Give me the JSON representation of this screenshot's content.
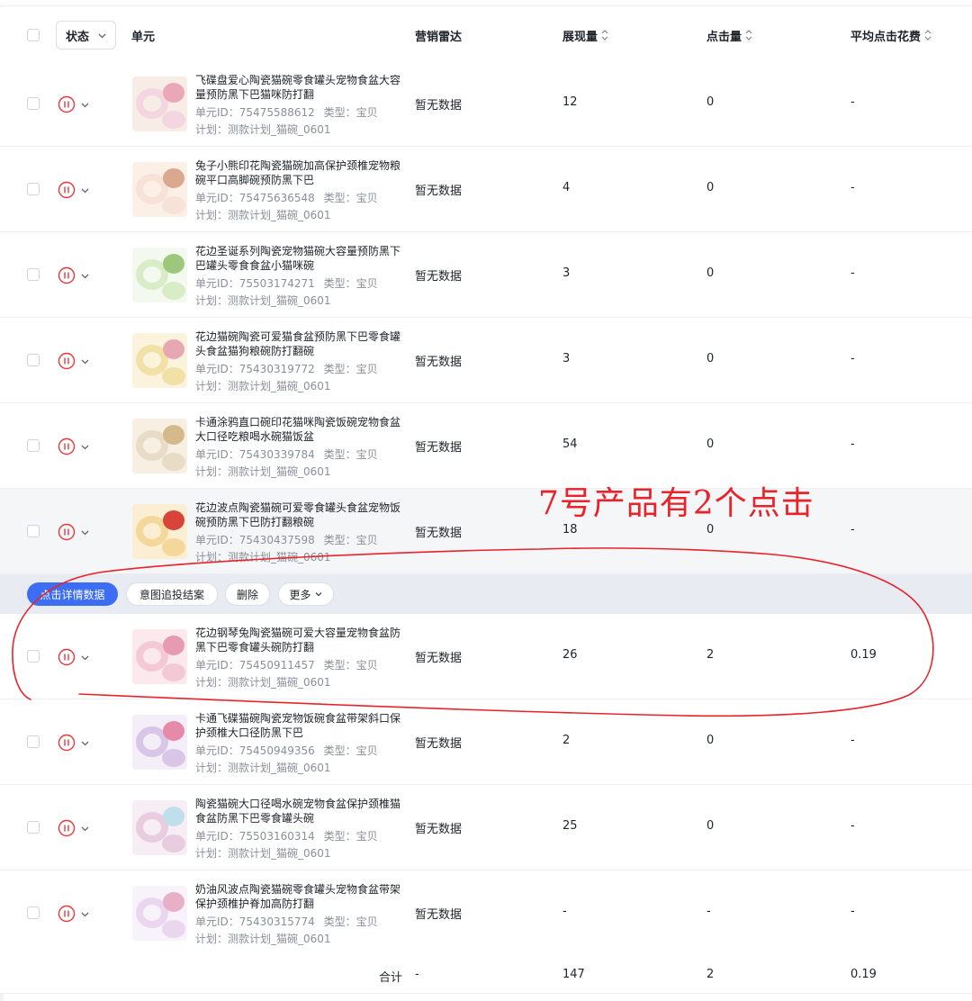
{
  "header": {
    "status_label": "状态",
    "unit_label": "单元",
    "radar_label": "营销雷达",
    "impressions_label": "展现量",
    "clicks_label": "点击量",
    "avg_cost_label": "平均点击花费"
  },
  "rows": [
    {
      "title": "飞碟盘爱心陶瓷猫碗零食罐头宠物食盆大容量预防黑下巴猫咪防打翻",
      "unit_id": "单元ID：75475588612",
      "type": "类型：宝贝",
      "plan": "计划：测款计划_猫碗_0601",
      "radar": "暂无数据",
      "impressions": "12",
      "clicks": "0",
      "avg_cost": "-"
    },
    {
      "title": "兔子小熊印花陶瓷猫碗加高保护颈椎宠物粮碗平口高脚碗预防黑下巴",
      "unit_id": "单元ID：75475636548",
      "type": "类型：宝贝",
      "plan": "计划：测款计划_猫碗_0601",
      "radar": "暂无数据",
      "impressions": "4",
      "clicks": "0",
      "avg_cost": "-"
    },
    {
      "title": "花边圣诞系列陶瓷宠物猫碗大容量预防黑下巴罐头零食食盆小猫咪碗",
      "unit_id": "单元ID：75503174271",
      "type": "类型：宝贝",
      "plan": "计划：测款计划_猫碗_0601",
      "radar": "暂无数据",
      "impressions": "3",
      "clicks": "0",
      "avg_cost": "-"
    },
    {
      "title": "花边猫碗陶瓷可爱猫食盆预防黑下巴零食罐头食盆猫狗粮碗防打翻碗",
      "unit_id": "单元ID：75430319772",
      "type": "类型：宝贝",
      "plan": "计划：测款计划_猫碗_0601",
      "radar": "暂无数据",
      "impressions": "3",
      "clicks": "0",
      "avg_cost": "-"
    },
    {
      "title": "卡通涂鸦直口碗印花猫咪陶瓷饭碗宠物食盆大口径吃粮喝水碗猫饭盆",
      "unit_id": "单元ID：75430339784",
      "type": "类型：宝贝",
      "plan": "计划：测款计划_猫碗_0601",
      "radar": "暂无数据",
      "impressions": "54",
      "clicks": "0",
      "avg_cost": "-"
    },
    {
      "title": "花边波点陶瓷猫碗可爱零食罐头食盆宠物饭碗预防黑下巴防打翻粮碗",
      "unit_id": "单元ID：75430437598",
      "type": "类型：宝贝",
      "plan": "计划：测款计划_猫碗_0601",
      "radar": "暂无数据",
      "impressions": "18",
      "clicks": "0",
      "avg_cost": "-"
    },
    {
      "title": "花边钢琴兔陶瓷猫碗可爱大容量宠物食盆防黑下巴零食罐头碗防打翻",
      "unit_id": "单元ID：75450911457",
      "type": "类型：宝贝",
      "plan": "计划：测款计划_猫碗_0601",
      "radar": "暂无数据",
      "impressions": "26",
      "clicks": "2",
      "avg_cost": "0.19"
    },
    {
      "title": "卡通飞碟猫碗陶瓷宠物饭碗食盆带架斜口保护颈椎大口径防黑下巴",
      "unit_id": "单元ID：75450949356",
      "type": "类型：宝贝",
      "plan": "计划：测款计划_猫碗_0601",
      "radar": "暂无数据",
      "impressions": "2",
      "clicks": "0",
      "avg_cost": "-"
    },
    {
      "title": "陶瓷猫碗大口径喝水碗宠物食盆保护颈椎猫食盆防黑下巴零食罐头碗",
      "unit_id": "单元ID：75503160314",
      "type": "类型：宝贝",
      "plan": "计划：测款计划_猫碗_0601",
      "radar": "暂无数据",
      "impressions": "25",
      "clicks": "0",
      "avg_cost": "-"
    },
    {
      "title": "奶油风波点陶瓷猫碗零食罐头宠物食盆带架保护颈椎护脊加高防打翻",
      "unit_id": "单元ID：75430315774",
      "type": "类型：宝贝",
      "plan": "计划：测款计划_猫碗_0601",
      "radar": "暂无数据",
      "impressions": "-",
      "clicks": "-",
      "avg_cost": "-"
    }
  ],
  "action_bar": {
    "click_detail_label": "点击详情数据",
    "intent_label": "意图追投结案",
    "delete_label": "删除",
    "more_label": "更多"
  },
  "total": {
    "label": "合计",
    "radar": "-",
    "impressions": "147",
    "clicks": "2",
    "avg_cost": "0.19"
  },
  "annotation": {
    "text": "7号产品有2个点击",
    "color": "#e8232a"
  },
  "colors": {
    "primary": "#3d6df2",
    "pause": "#e8383d"
  }
}
